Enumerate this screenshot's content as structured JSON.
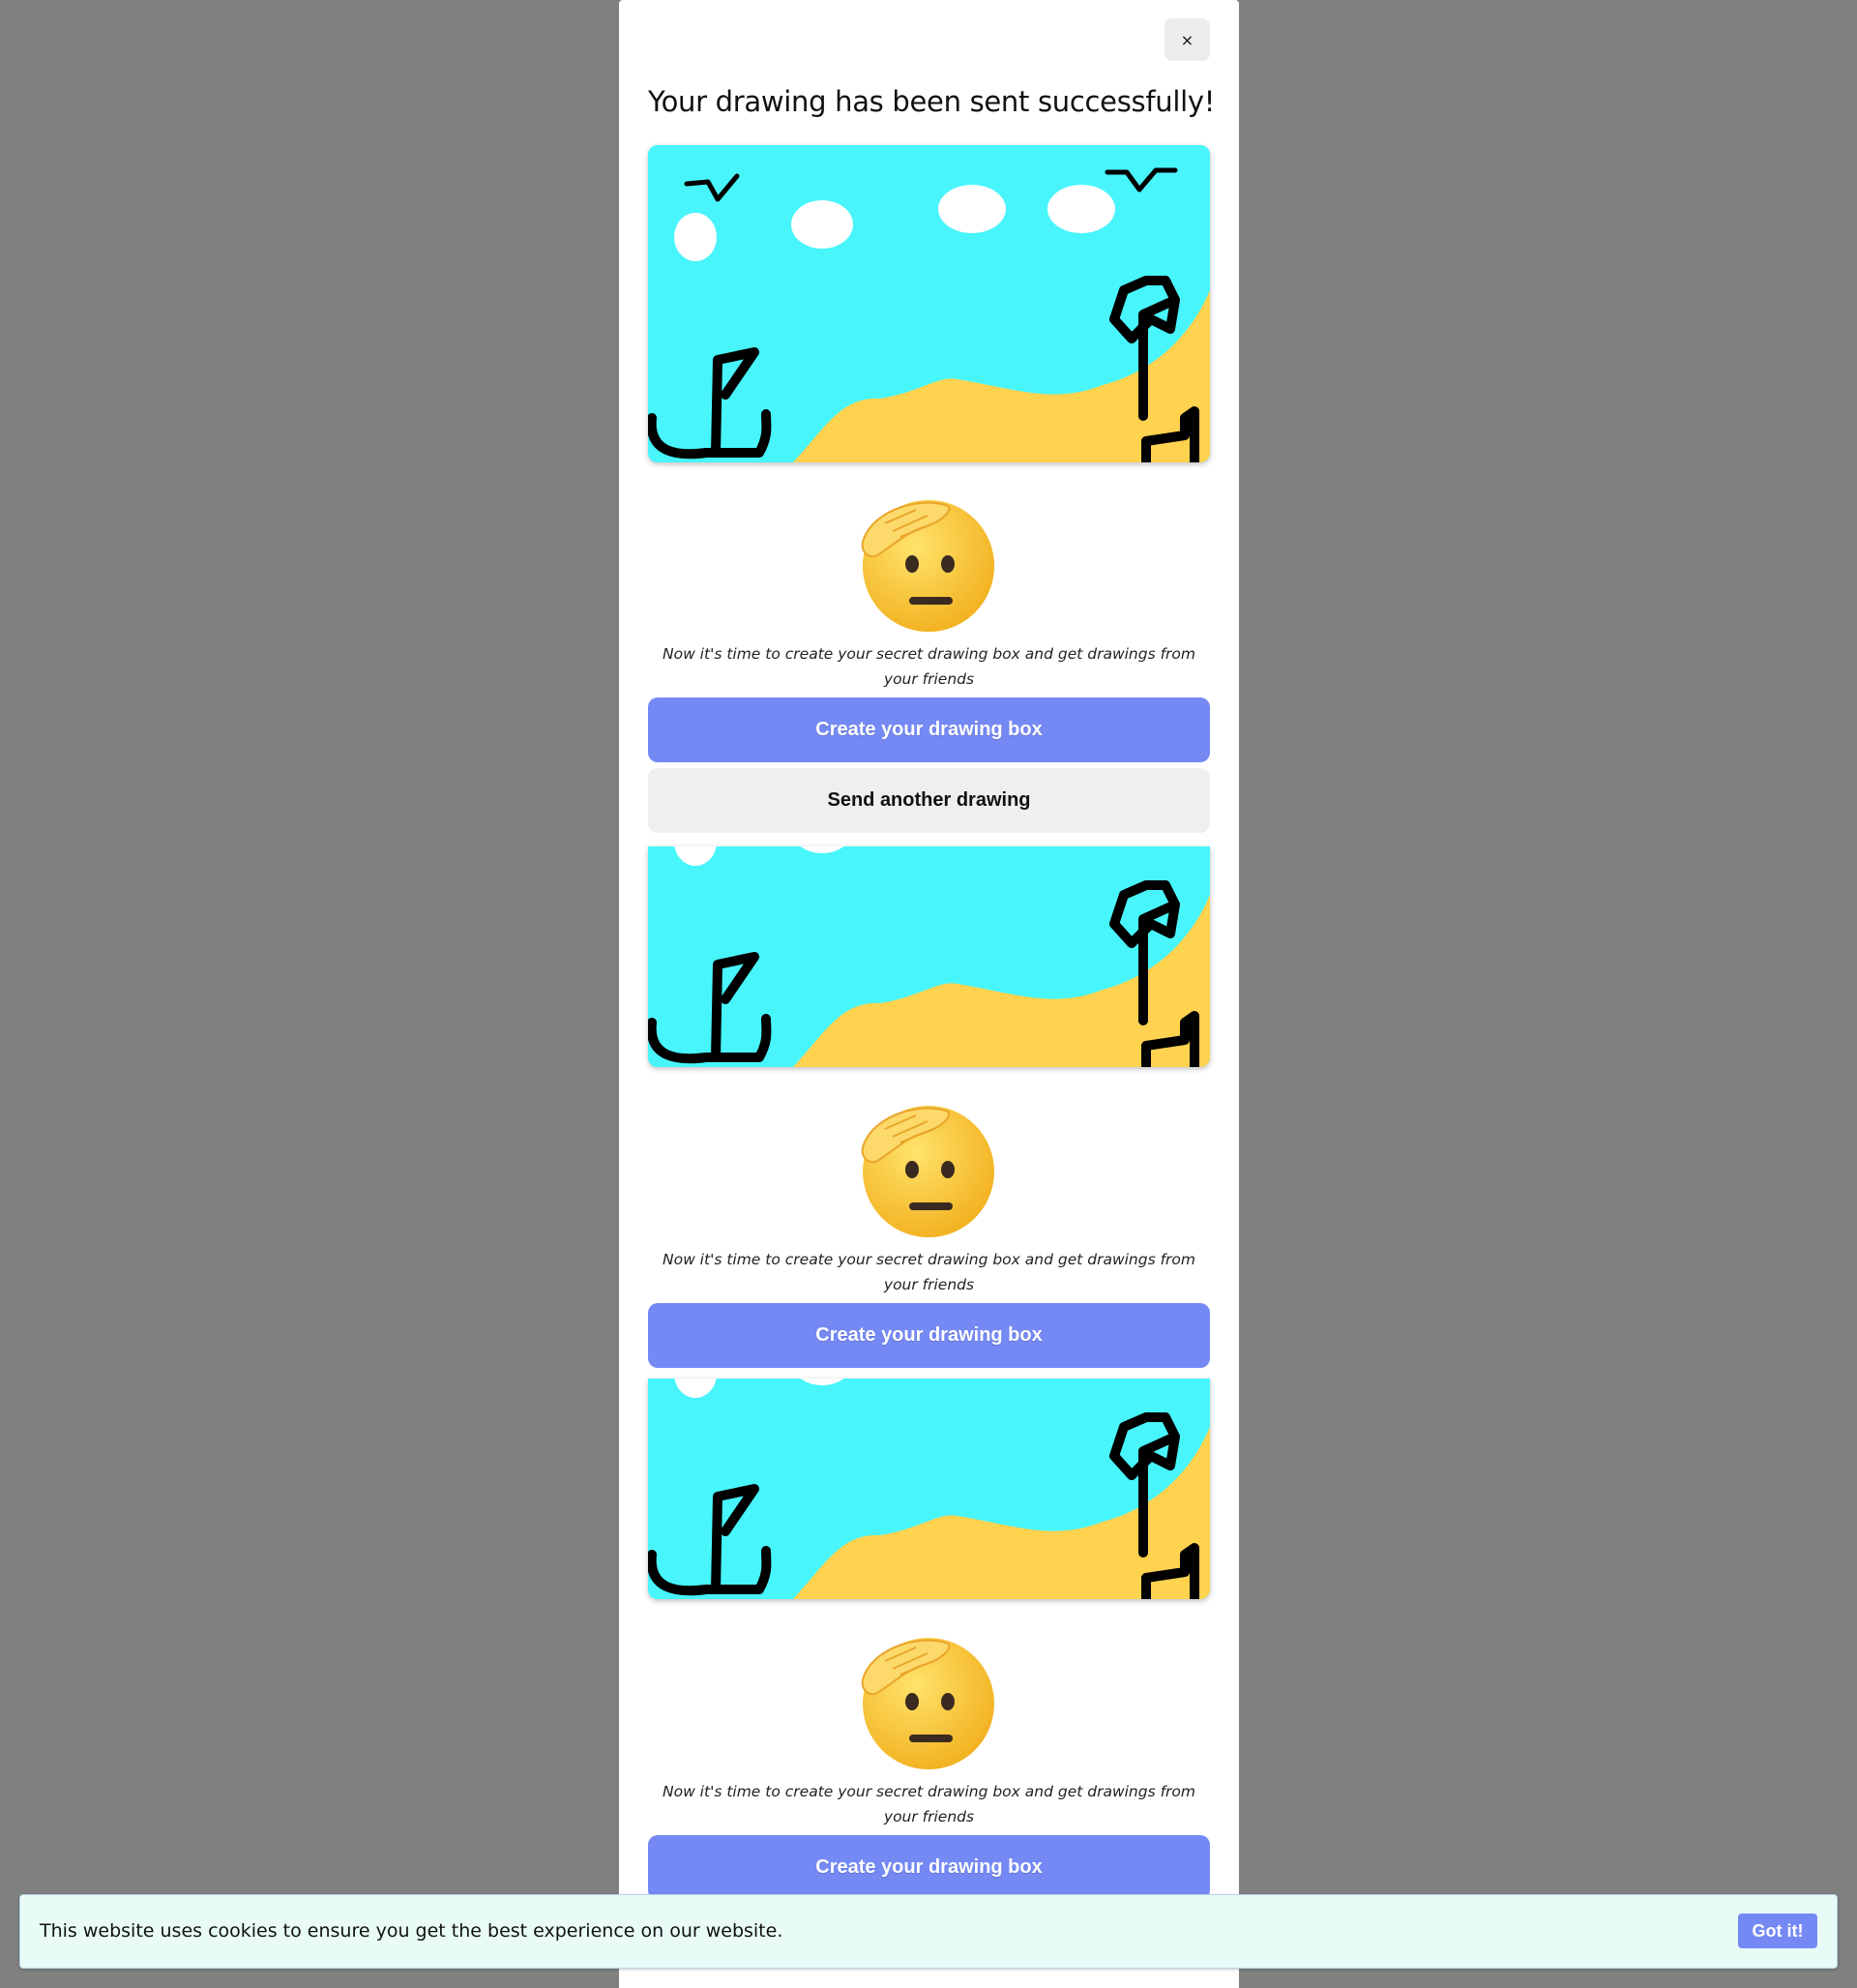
{
  "modal": {
    "close_label": "×",
    "title": "Your drawing has been sent successfully!"
  },
  "sections": [
    {
      "message": "Now it's time to create your secret drawing box and get drawings from your friends",
      "create_button": "Create your drawing box",
      "send_another_button": "Send another drawing"
    },
    {
      "message": "Now it's time to create your secret drawing box and get drawings from your friends",
      "create_button": "Create your drawing box"
    },
    {
      "message": "Now it's time to create your secret drawing box and get drawings from your friends",
      "create_button": "Create your drawing box"
    }
  ],
  "cookie": {
    "text": "This website uses cookies to ensure you get the best experience on our website.",
    "accept_button": "Got it!"
  },
  "colors": {
    "backdrop": "#808080",
    "primary_button": "#7589f4",
    "secondary_button": "#efefef",
    "sky": "#48f5fb",
    "sand": "#ffd24f",
    "cookie_bar": "#e8fbf7"
  },
  "icons": {
    "close": "close-icon",
    "emoji": "saluting-face-icon"
  }
}
